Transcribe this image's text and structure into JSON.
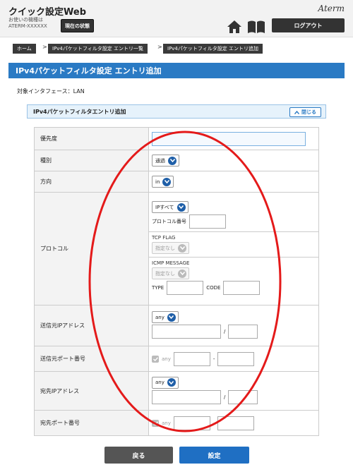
{
  "header": {
    "app_title": "クイック設定Web",
    "device_label": "お使いの機種は",
    "device_name": "ATERM-XXXXXX",
    "status_button": "現在の状態",
    "brand": "Aterm",
    "logout_button": "ログアウト",
    "icons": [
      "home-icon",
      "book-icon"
    ]
  },
  "breadcrumb": [
    "ホーム",
    "IPv4パケットフィルタ設定 エントリ一覧",
    "IPv4パケットフィルタ設定 エントリ追加"
  ],
  "page_title": "IPv4パケットフィルタ設定 エントリ追加",
  "interface_label": "対象インタフェース：LAN",
  "panel": {
    "title": "IPv4パケットフィルタエントリ追加",
    "close_button": "閉じる"
  },
  "form": {
    "priority": {
      "label": "優先度",
      "value": ""
    },
    "type": {
      "label": "種別",
      "selected": "通過"
    },
    "direction": {
      "label": "方向",
      "selected": "in"
    },
    "protocol": {
      "label": "プロトコル",
      "selected": "IPすべて",
      "number_label": "プロトコル番号",
      "tcp_flag_label": "TCP FLAG",
      "tcp_flag_selected": "指定なし",
      "icmp_label": "ICMP MESSAGE",
      "icmp_selected": "指定なし",
      "type_label": "TYPE",
      "code_label": "CODE"
    },
    "src_ip": {
      "label": "送信元IPアドレス",
      "selected": "any",
      "slash": "/"
    },
    "src_port": {
      "label": "送信元ポート番号",
      "any_label": "any",
      "dash": "-"
    },
    "dst_ip": {
      "label": "宛先IPアドレス",
      "selected": "any",
      "slash": "/"
    },
    "dst_port": {
      "label": "宛先ポート番号",
      "any_label": "any",
      "dash": "-"
    }
  },
  "buttons": {
    "back": "戻る",
    "set": "設定"
  },
  "colors": {
    "accent": "#2a7ac4",
    "annotation": "#e41a1a"
  }
}
